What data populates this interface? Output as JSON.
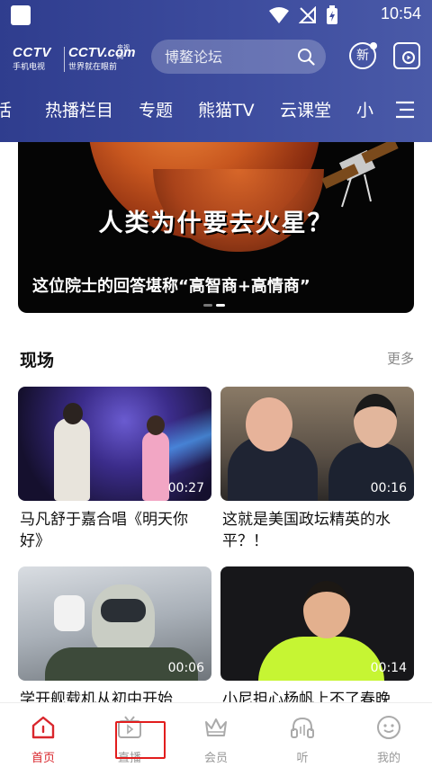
{
  "status_bar": {
    "time": "10:54"
  },
  "logo": {
    "left_brand": "CCTV",
    "left_sub": "手机电视",
    "right_brand": "CCTV.com",
    "right_badge": "央视网",
    "right_sub": "世界就在眼前"
  },
  "search": {
    "placeholder": "博鳌论坛"
  },
  "header_buttons": {
    "new_label": "新"
  },
  "tabs": [
    "活",
    "热播栏目",
    "专题",
    "熊猫TV",
    "云课堂",
    "小"
  ],
  "banner": {
    "headline": "人类为什要去火星？",
    "caption": "这位院士的回答堪称“高智商+高情商”"
  },
  "section": {
    "title": "现场",
    "more": "更多"
  },
  "cards": [
    {
      "duration": "00:27",
      "title": "马凡舒于嘉合唱《明天你好》"
    },
    {
      "duration": "00:16",
      "title": "这就是美国政坛精英的水平？！"
    },
    {
      "duration": "00:06",
      "title": "学开舰载机从初中开始"
    },
    {
      "duration": "00:14",
      "title": "小尼担心杨帆上不了春晚"
    }
  ],
  "bottom_nav": [
    {
      "label": "首页",
      "icon": "home-icon",
      "active": true
    },
    {
      "label": "直播",
      "icon": "tv-icon",
      "active": false
    },
    {
      "label": "会员",
      "icon": "crown-icon",
      "active": false
    },
    {
      "label": "听",
      "icon": "headphones-icon",
      "active": false
    },
    {
      "label": "我的",
      "icon": "profile-icon",
      "active": false
    }
  ],
  "colors": {
    "header": "#3d4c9e",
    "accent_red": "#d9262c",
    "highlight": "#e21d1d"
  }
}
